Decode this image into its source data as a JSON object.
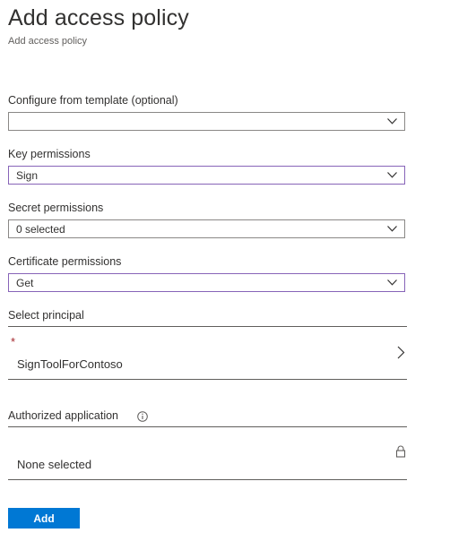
{
  "header": {
    "title": "Add access policy",
    "breadcrumb": "Add access policy"
  },
  "form": {
    "template": {
      "label": "Configure from template (optional)",
      "value": ""
    },
    "key_permissions": {
      "label": "Key permissions",
      "value": "Sign"
    },
    "secret_permissions": {
      "label": "Secret permissions",
      "value": "0 selected"
    },
    "certificate_permissions": {
      "label": "Certificate permissions",
      "value": "Get"
    },
    "principal": {
      "label": "Select principal",
      "required_marker": "*",
      "value": "SignToolForContoso"
    },
    "authorized_application": {
      "label": "Authorized application",
      "value": "None selected"
    }
  },
  "actions": {
    "add_label": "Add"
  },
  "icons": {
    "dropdown": "chevron-down-icon",
    "principal_nav": "chevron-right-icon",
    "info": "info-icon",
    "locked": "lock-icon"
  },
  "colors": {
    "accent": "#0078d4",
    "focus_border": "#8764b8",
    "required": "#a4262c",
    "border": "#8a8886"
  }
}
